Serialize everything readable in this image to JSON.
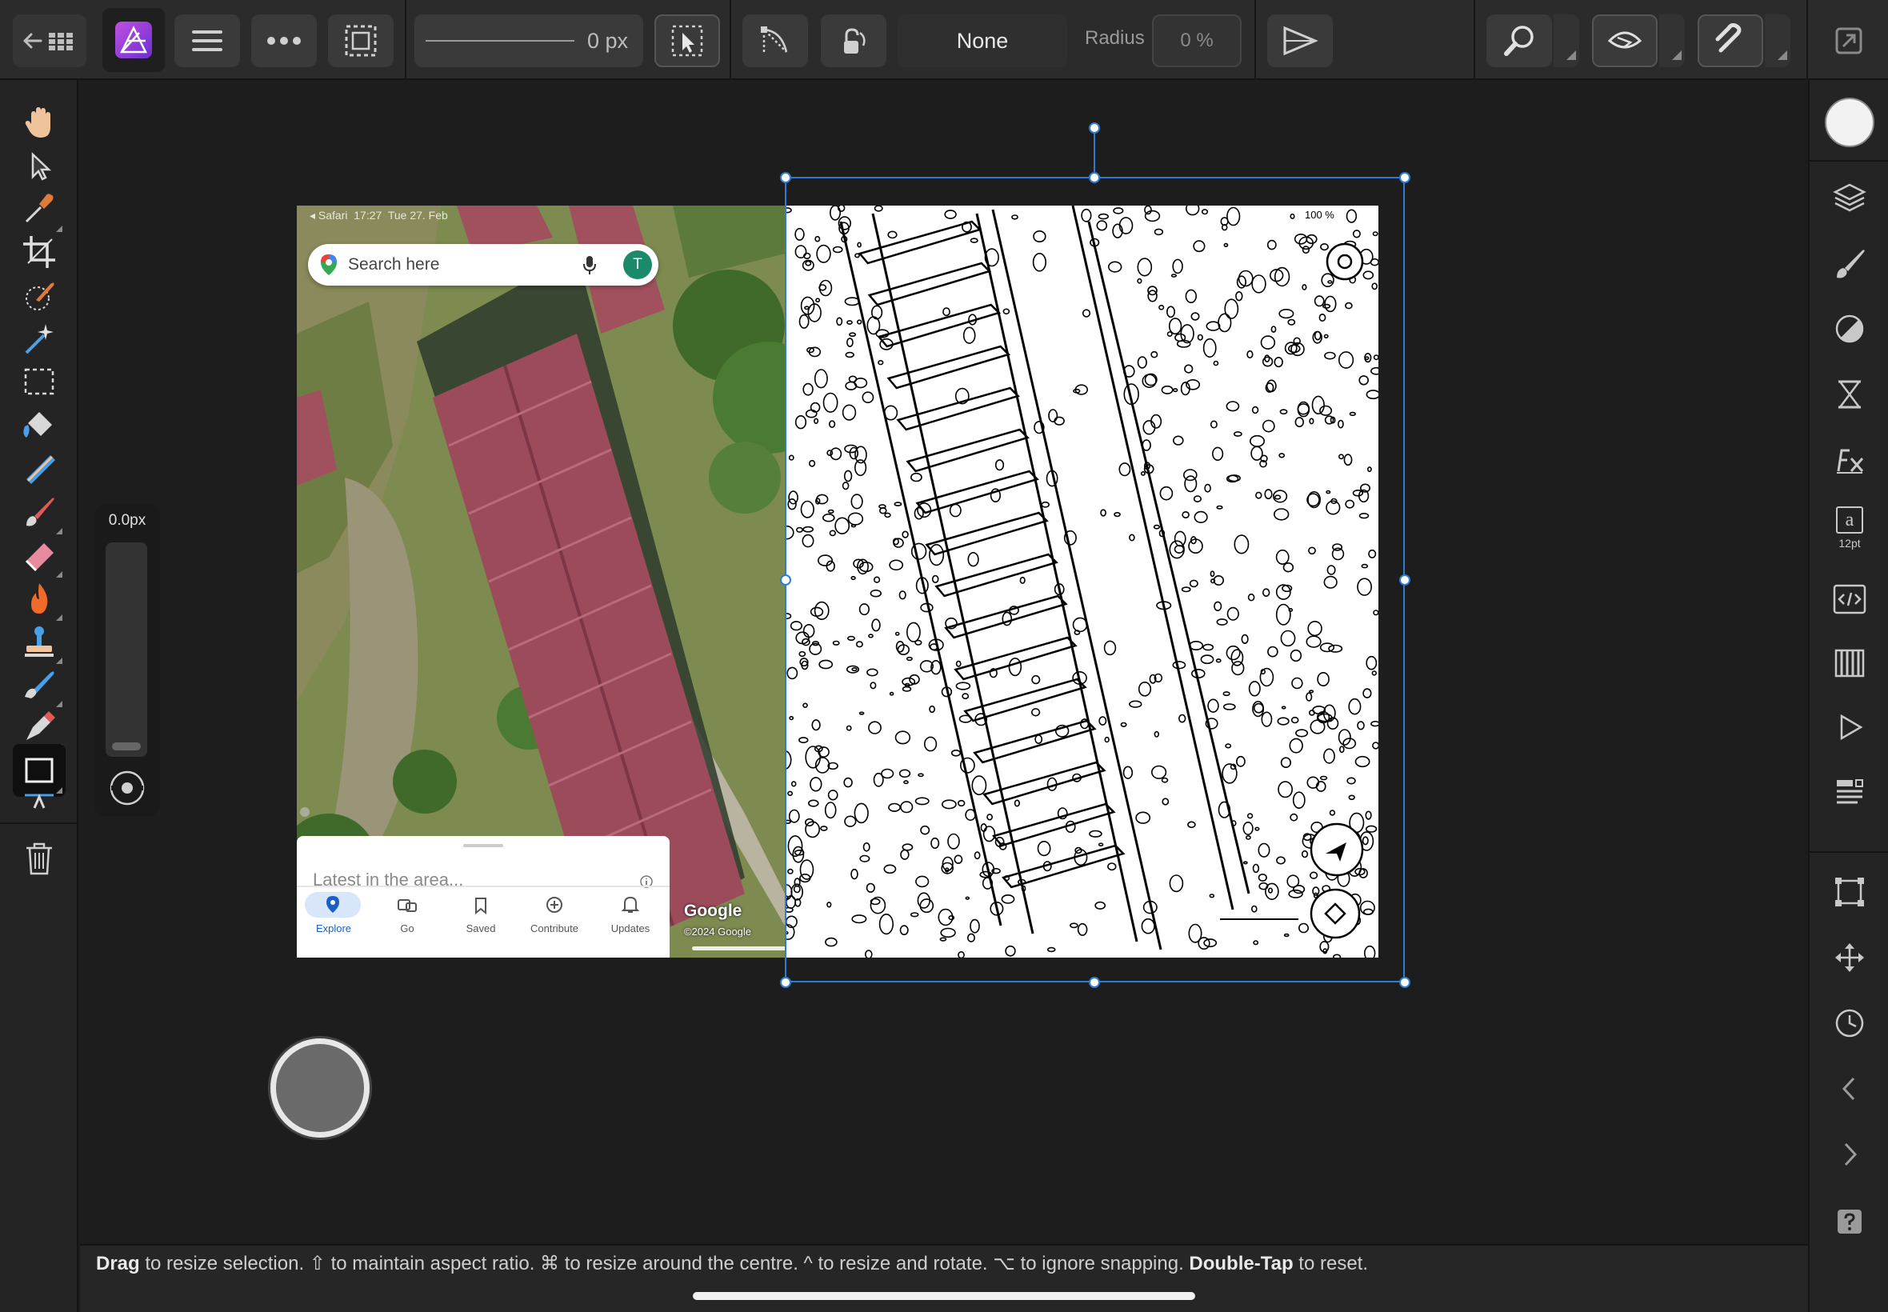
{
  "toolbar": {
    "stroke_width": "0 px",
    "fill_value": "None",
    "radius_label": "Radius",
    "radius_value": "0 %"
  },
  "slider": {
    "value": "0.0px"
  },
  "right_panel": {
    "text_size_label": "12pt",
    "text_glyph": "a"
  },
  "map": {
    "status_bar_text": "◂ Safari  17:27  Tue 27. Feb",
    "battery_text": "100 %",
    "search_placeholder": "Search here",
    "avatar_letter": "T",
    "sheet_title": "Latest in the area...",
    "tabs": [
      {
        "label": "Explore"
      },
      {
        "label": "Go"
      },
      {
        "label": "Saved"
      },
      {
        "label": "Contribute"
      },
      {
        "label": "Updates"
      }
    ],
    "brand": "Google",
    "copyright": "©2024 Google"
  },
  "status": {
    "parts": [
      {
        "bold": "Drag",
        "text": " to resize selection. ⇧ to maintain aspect ratio. ⌘ to resize around the centre. ^ to resize and rotate. ⌥ to ignore snapping. "
      },
      {
        "bold": "Double-Tap",
        "text": " to reset."
      }
    ]
  },
  "colors": {
    "accent": "#2e7bd6",
    "app_icon": "#9b3fd6",
    "background": "#1d1d1d",
    "toolbar": "#2b2b2b",
    "roof": "#9c4b5a",
    "grass": "#7c8a4d"
  }
}
